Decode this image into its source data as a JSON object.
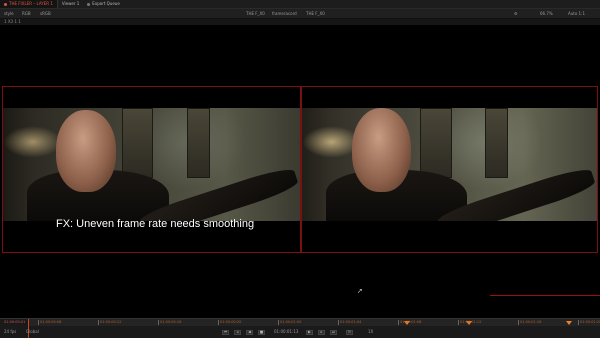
{
  "tabs": [
    {
      "label": "THE FIXLER – LAYER 1",
      "active": true
    },
    {
      "label": "Viewer 1",
      "active": false
    },
    {
      "label": "Export Queue",
      "active": false
    }
  ],
  "toolbar": {
    "left_items": [
      "style",
      "RGB",
      "sRGB"
    ],
    "center_left": "THE F_X0",
    "center_mid": "frameracord",
    "center_right": "THE F_X0",
    "zoom": "66.7%",
    "fit": "Auto 1:1"
  },
  "subbar": {
    "left": "1  X3  1  1"
  },
  "caption": "FX: Uneven frame rate needs smoothing",
  "timeline": {
    "start_timecode": "01:00:00:01",
    "ruler_labels": [
      "01:00:00:08",
      "01:00:00:12",
      "01:00:00:16",
      "01:00:00:20",
      "01:00:01:00",
      "01:00:01:04",
      "01:00:01:08",
      "01:00:01:12",
      "01:00:01:16",
      "01:00:01:20"
    ],
    "fps": "24 fps",
    "mode": "Global",
    "current_timecode": "01:00:01:13",
    "speed": "1X"
  },
  "colors": {
    "accent": "#e0543c",
    "viewer_border": "#7a1010",
    "marker": "#f08020"
  }
}
